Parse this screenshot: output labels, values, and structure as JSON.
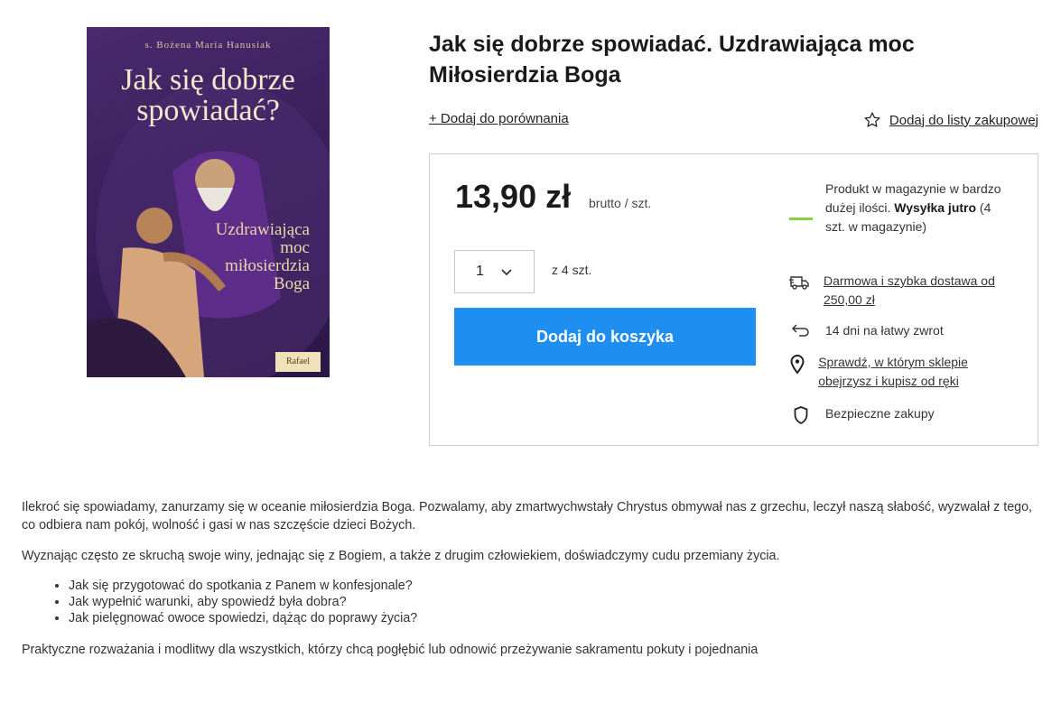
{
  "product": {
    "title": "Jak się dobrze spowiadać. Uzdrawiająca moc Miłosierdzia Boga",
    "cover": {
      "author": "s. Bożena Maria Hanusiak",
      "title": "Jak się dobrze\nspowiadać?",
      "subtitle": "Uzdrawiająca\nmoc\nmiłosierdzia\nBoga",
      "publisher": "Rafael"
    }
  },
  "actions": {
    "compare_label": "+ Dodaj do porównania",
    "shopping_list_label": "Dodaj do listy zakupowej"
  },
  "buy": {
    "price": "13,90 zł",
    "price_unit": "brutto / szt.",
    "quantity": "1",
    "quantity_of": "z 4 szt.",
    "add_to_cart": "Dodaj do koszyka"
  },
  "info": {
    "stock_text": "Produkt w magazynie w bardzo dużej ilości.",
    "shipping_bold": "Wysyłka jutro",
    "shipping_rest": " (4 szt. w magazynie)",
    "free_delivery": "Darmowa i szybka dostawa od 250,00 zł",
    "returns": "14 dni na łatwy zwrot",
    "store_check": "Sprawdź, w którym sklepie obejrzysz i kupisz od ręki",
    "secure": "Bezpieczne zakupy",
    "stock_color": "#8ccf3e"
  },
  "description": {
    "p1": "Ilekroć się spowiadamy, zanurzamy się w oceanie miłosierdzia Boga. Pozwalamy, aby zmartwychwstały Chrystus obmywał nas z grzechu, leczył naszą słabość, wyzwalał z tego, co odbiera nam pokój, wolność i gasi w nas szczęście dzieci Bożych.",
    "p2": "Wyznając często ze skruchą swoje winy, jednając się z Bogiem, a także z drugim człowiekiem, doświadczymy cudu przemiany życia.",
    "bullets": [
      "Jak się przygotować do spotkania z Panem w konfesjonale?",
      "Jak wypełnić warunki, aby spowiedź była dobra?",
      "Jak pielęgnować owoce spowiedzi, dążąc do poprawy życia?"
    ],
    "p3": "Praktyczne rozważania i modlitwy dla wszystkich, którzy chcą pogłębić lub odnowić przeżywanie sakramentu pokuty i pojednania"
  },
  "colors": {
    "accent": "#1e8ff0"
  }
}
